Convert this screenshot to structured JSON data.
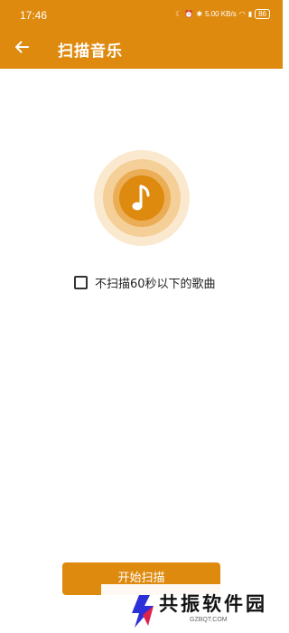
{
  "status_bar": {
    "time": "17:46",
    "network_speed": "5.00 KB/s",
    "battery": "86"
  },
  "header": {
    "title": "扫描音乐",
    "back_icon": "arrow-left-icon"
  },
  "scan": {
    "icon": "music-note-icon",
    "skip_short_label": "不扫描60秒以下的歌曲",
    "skip_short_checked": false
  },
  "footer": {
    "start_button_label": "开始扫描"
  },
  "watermark": {
    "name": "共振软件园",
    "site": "GZBQT.COM"
  },
  "colors": {
    "accent": "#de8a0e",
    "ring_outer": "#fbe9cf",
    "ring_mid": "#f4cf97",
    "ring_inner": "#ebae57"
  }
}
